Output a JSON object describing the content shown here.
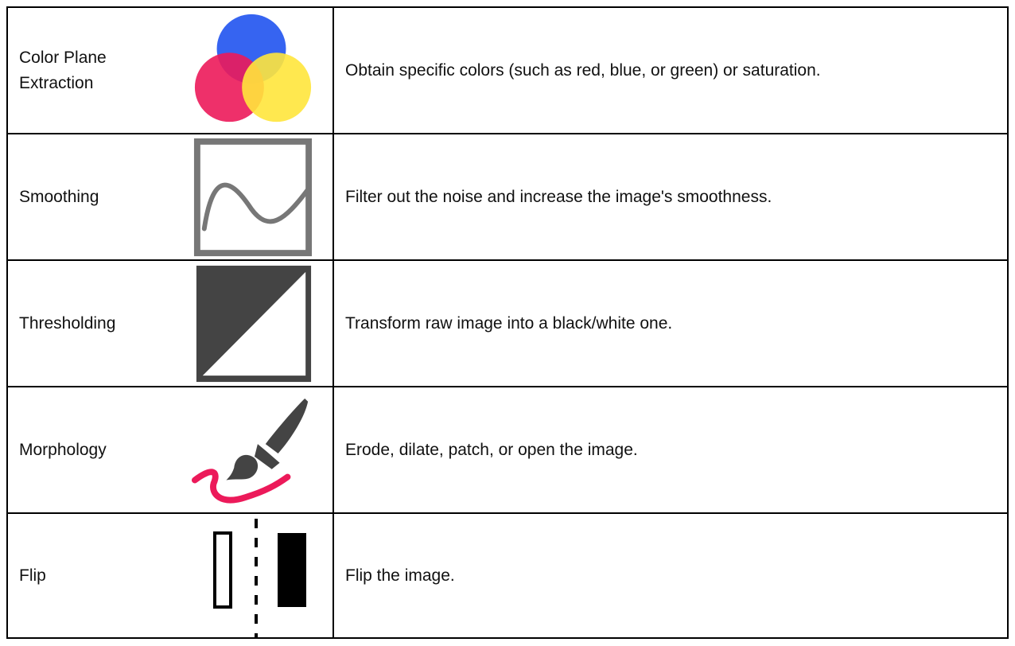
{
  "rows": [
    {
      "name": "Color Plane Extraction",
      "icon": "color-circles-icon",
      "description": "Obtain specific colors (such as red, blue, or green) or saturation."
    },
    {
      "name": "Smoothing",
      "icon": "wave-frame-icon",
      "description": "Filter out the noise and increase the image's smoothness."
    },
    {
      "name": "Thresholding",
      "icon": "diagonal-split-icon",
      "description": "Transform raw image into a black/white one."
    },
    {
      "name": "Morphology",
      "icon": "paintbrush-icon",
      "description": "Erode, dilate, patch, or open the image."
    },
    {
      "name": "Flip",
      "icon": "mirror-flip-icon",
      "description": "Flip the image."
    }
  ],
  "colors": {
    "blue": "#2b5cf0",
    "red": "#ec1a5a",
    "yellow": "#ffe63c",
    "gray": "#777777",
    "dark": "#444444"
  }
}
